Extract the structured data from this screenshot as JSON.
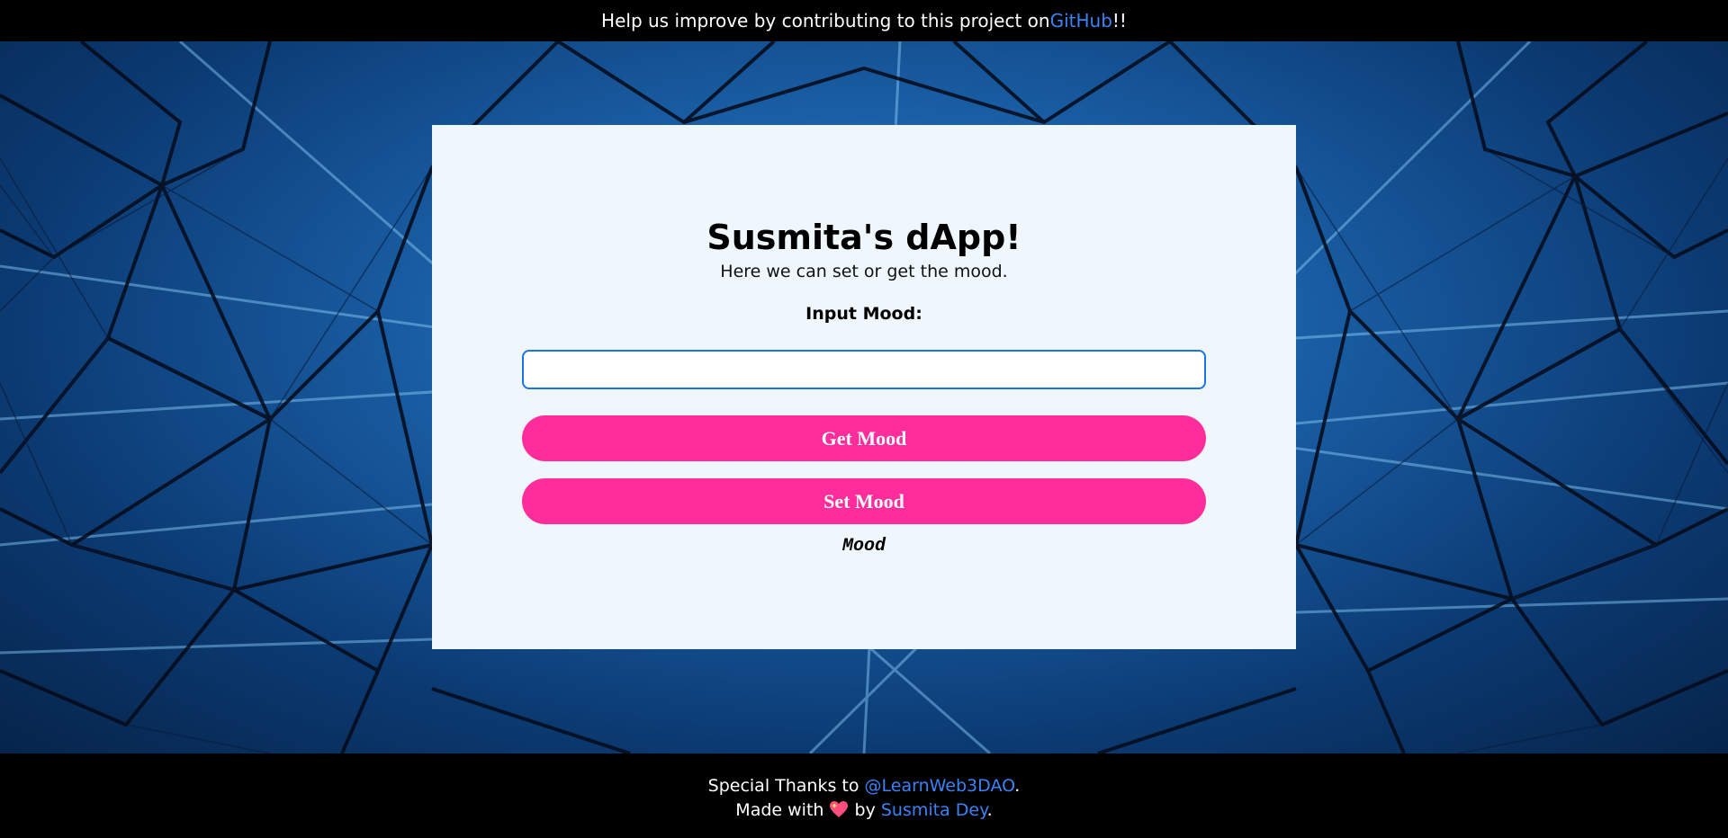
{
  "banner": {
    "text_before": "Help us improve by contributing to this project on ",
    "link_label": "GitHub",
    "text_after": "!!"
  },
  "card": {
    "title": "Susmita's dApp!",
    "subtitle": "Here we can set or get the mood.",
    "input_label": "Input Mood:",
    "input_value": "",
    "get_button_label": "Get Mood",
    "set_button_label": "Set Mood",
    "mood_output": "Mood"
  },
  "footer": {
    "thanks_before": "Special Thanks to ",
    "thanks_link": "@LearnWeb3DAO",
    "thanks_after": ".",
    "made_before": "Made with ",
    "made_by": " by ",
    "author_link": "Susmita Dey",
    "made_after": "."
  },
  "icons": {
    "heart": "sparkling-heart-icon"
  },
  "colors": {
    "accent_button": "#ff2d9b",
    "link": "#3b82f6",
    "card_background": "#eff7fd",
    "input_border": "#1a73e8"
  }
}
